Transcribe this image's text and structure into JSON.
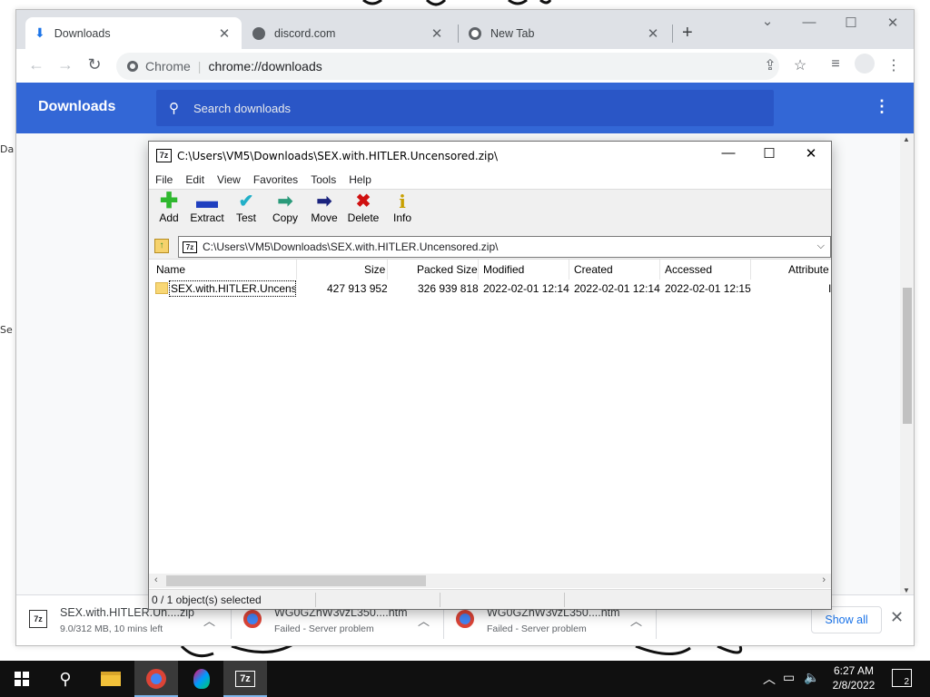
{
  "chrome": {
    "tabs": [
      {
        "title": "Downloads",
        "icon": "download-icon"
      },
      {
        "title": "discord.com",
        "icon": "globe-icon"
      },
      {
        "title": "New Tab",
        "icon": "chrome-icon"
      }
    ],
    "omnibox": {
      "site": "Chrome",
      "url": "chrome://downloads"
    }
  },
  "downloads_page": {
    "title": "Downloads",
    "search_placeholder": "Search downloads"
  },
  "zip_window": {
    "title": "C:\\Users\\VM5\\Downloads\\SEX.with.HITLER.Uncensored.zip\\",
    "menu": [
      "File",
      "Edit",
      "View",
      "Favorites",
      "Tools",
      "Help"
    ],
    "toolbar": [
      {
        "label": "Add",
        "icon": "plus-icon",
        "color": "#2eb82e"
      },
      {
        "label": "Extract",
        "icon": "minus-icon",
        "color": "#1f3fbf"
      },
      {
        "label": "Test",
        "icon": "check-icon",
        "color": "#22b0c8"
      },
      {
        "label": "Copy",
        "icon": "double-arrow-icon",
        "color": "#2a9a7a"
      },
      {
        "label": "Move",
        "icon": "arrow-right-icon",
        "color": "#1a237e"
      },
      {
        "label": "Delete",
        "icon": "x-icon",
        "color": "#d01010"
      },
      {
        "label": "Info",
        "icon": "info-icon",
        "color": "#c8a000"
      }
    ],
    "path": "C:\\Users\\VM5\\Downloads\\SEX.with.HITLER.Uncensored.zip\\",
    "columns": [
      "Name",
      "Size",
      "Packed Size",
      "Modified",
      "Created",
      "Accessed",
      "Attribute"
    ],
    "rows": [
      {
        "name": "SEX.with.HITLER.Uncens...",
        "size": "427 913 952",
        "packed": "326 939 818",
        "modified": "2022-02-01 12:14",
        "created": "2022-02-01 12:14",
        "accessed": "2022-02-01 12:15",
        "attr": "I"
      }
    ],
    "status": "0 / 1 object(s) selected"
  },
  "shelf": {
    "items": [
      {
        "name": "SEX.with.HITLER.Un....zip",
        "status": "9.0/312 MB, 10 mins left",
        "icon": "7zip-icon"
      },
      {
        "name": "WG0GZnW3vzL350....htm",
        "status": "Failed - Server problem",
        "icon": "chrome-icon"
      },
      {
        "name": "WG0GZnW3vzL350....htm",
        "status": "Failed - Server problem",
        "icon": "chrome-icon"
      }
    ],
    "show_all": "Show all"
  },
  "taskbar": {
    "time": "6:27 AM",
    "date": "2/8/2022",
    "notifications": "2"
  },
  "desktop_edge": [
    "Da",
    "Se"
  ]
}
